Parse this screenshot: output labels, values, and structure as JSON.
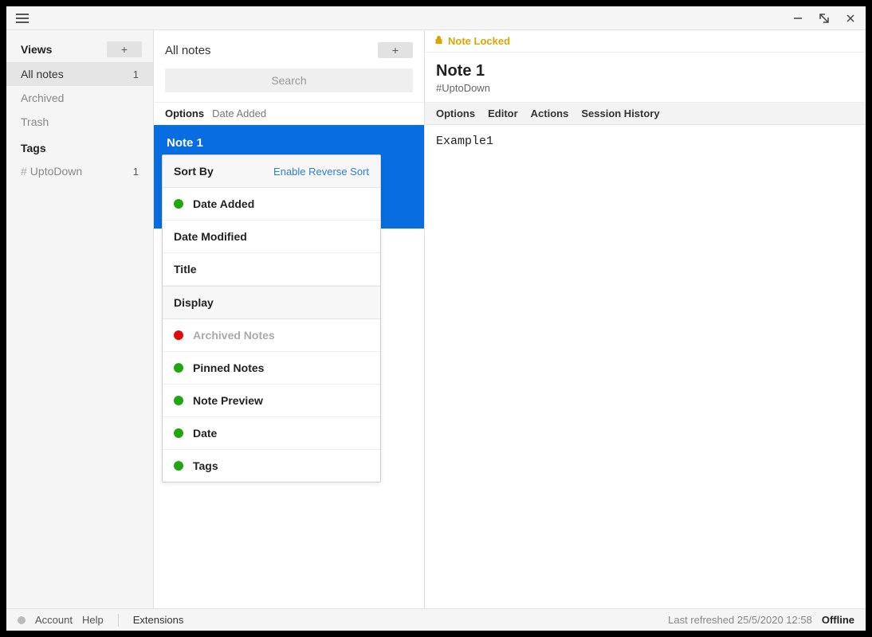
{
  "sidebar": {
    "views_label": "Views",
    "items": [
      {
        "label": "All notes",
        "count": "1",
        "active": true
      },
      {
        "label": "Archived",
        "count": "",
        "active": false
      },
      {
        "label": "Trash",
        "count": "",
        "active": false
      }
    ],
    "tags_label": "Tags",
    "tags": [
      {
        "label": "UptoDown",
        "count": "1"
      }
    ]
  },
  "mid": {
    "title": "All notes",
    "search_placeholder": "Search",
    "options_label": "Options",
    "options_value": "Date Added",
    "selected_note_title": "Note 1"
  },
  "popup": {
    "sortby_label": "Sort By",
    "reverse_label": "Enable Reverse Sort",
    "sort_items": [
      {
        "label": "Date Added",
        "dot": "green"
      },
      {
        "label": "Date Modified",
        "dot": ""
      },
      {
        "label": "Title",
        "dot": ""
      }
    ],
    "display_label": "Display",
    "display_items": [
      {
        "label": "Archived Notes",
        "dot": "red",
        "muted": true
      },
      {
        "label": "Pinned Notes",
        "dot": "green"
      },
      {
        "label": "Note Preview",
        "dot": "green"
      },
      {
        "label": "Date",
        "dot": "green"
      },
      {
        "label": "Tags",
        "dot": "green"
      }
    ]
  },
  "editor": {
    "locked_label": "Note Locked",
    "title": "Note 1",
    "tag": "#UptoDown",
    "tabs": [
      "Options",
      "Editor",
      "Actions",
      "Session History"
    ],
    "body": "Example1"
  },
  "status": {
    "account": "Account",
    "help": "Help",
    "extensions": "Extensions",
    "last_refreshed": "Last refreshed 25/5/2020 12:58",
    "offline": "Offline"
  }
}
